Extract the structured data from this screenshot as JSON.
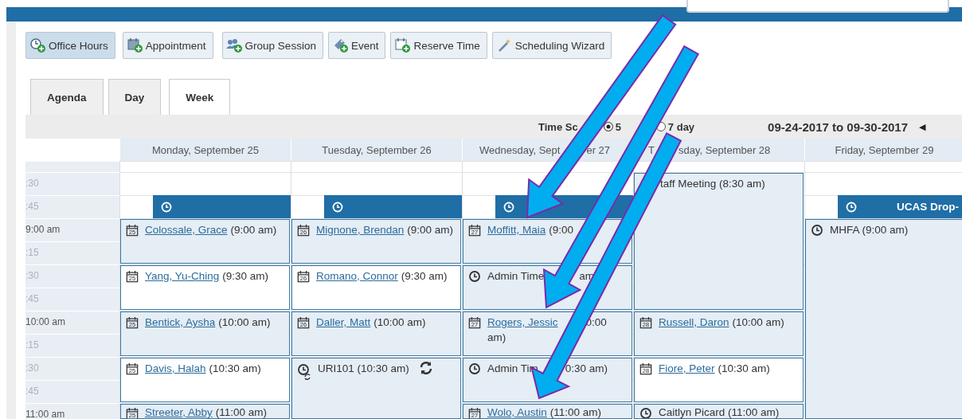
{
  "header_field": {
    "kind": "input"
  },
  "toolbar": [
    {
      "label": "Office Hours",
      "selected": true
    },
    {
      "label": "Appointment",
      "selected": false
    },
    {
      "label": "Group Session",
      "selected": false
    },
    {
      "label": "Event",
      "selected": false
    },
    {
      "label": "Reserve Time",
      "selected": false
    },
    {
      "label": "Scheduling Wizard",
      "selected": false
    }
  ],
  "tabs": [
    {
      "label": "Agenda",
      "selected": false
    },
    {
      "label": "Day",
      "selected": false
    },
    {
      "label": "Week",
      "selected": true
    }
  ],
  "time_scale": {
    "label": "Time Sc",
    "options": [
      {
        "label": "5",
        "selected": true
      },
      {
        "label": "7 day",
        "selected": false
      }
    ]
  },
  "date_range": "09-24-2017 to 09-30-2017",
  "prev_arrow": "◀",
  "time_labels": [
    ":30",
    ":45",
    "9:00 am",
    ":15",
    ":30",
    ":45",
    "10:00 am",
    ":15",
    ":30",
    ":45",
    "11:00 am"
  ],
  "days": [
    {
      "title": [
        "Monday, September 25"
      ],
      "bar": {
        "kind": "office_hours"
      },
      "events": [
        {
          "kind": "appointment",
          "icon_day": "25",
          "shaded": true,
          "parts": [
            {
              "text": "Colossale, Grace",
              "kind": "link"
            },
            {
              "text": "(9:00 am)",
              "kind": "text"
            }
          ]
        },
        {
          "kind": "appointment",
          "icon_day": "25",
          "shaded": false,
          "parts": [
            {
              "text": "Yang, Yu-Ching",
              "kind": "link"
            },
            {
              "text": "(9:30 am)",
              "kind": "text"
            }
          ]
        },
        {
          "kind": "appointment",
          "icon_day": "25",
          "shaded": true,
          "parts": [
            {
              "text": "Bentick, Aysha",
              "kind": "link"
            },
            {
              "text": "(10:00 am)",
              "kind": "text"
            }
          ]
        },
        {
          "kind": "appointment",
          "icon_day": "25",
          "shaded": false,
          "parts": [
            {
              "text": "Davis, Halah",
              "kind": "link"
            },
            {
              "text": "(10:30 am)",
              "kind": "text"
            }
          ]
        },
        {
          "kind": "appointment",
          "icon_day": "25",
          "shaded": true,
          "parts": [
            {
              "text": "Streeter, Abby",
              "kind": "link"
            },
            {
              "text": "(11:00 am)",
              "kind": "text"
            }
          ]
        }
      ]
    },
    {
      "title": [
        "Tuesday, September 26"
      ],
      "bar": {
        "kind": "office_hours"
      },
      "events": [
        {
          "kind": "appointment",
          "icon_day": "26",
          "shaded": true,
          "parts": [
            {
              "text": "Mignone, Brendan",
              "kind": "link"
            },
            {
              "text": "(9:00 am)",
              "kind": "text"
            }
          ]
        },
        {
          "kind": "appointment",
          "icon_day": "26",
          "shaded": false,
          "parts": [
            {
              "text": "Romano, Connor",
              "kind": "link"
            },
            {
              "text": "(9:30 am)",
              "kind": "text"
            }
          ]
        },
        {
          "kind": "appointment",
          "icon_day": "26",
          "shaded": true,
          "parts": [
            {
              "text": "Daller, Matt",
              "kind": "link"
            },
            {
              "text": "(10:00 am)",
              "kind": "text"
            }
          ]
        },
        {
          "kind": "recurring",
          "shaded": true,
          "parts": [
            {
              "text": "URI101 (10:30 am)",
              "kind": "text"
            }
          ]
        }
      ]
    },
    {
      "title": [
        "Wednesday, Sept",
        "er 27"
      ],
      "bar": {
        "kind": "office_hours"
      },
      "events": [
        {
          "kind": "appointment",
          "icon_day": "27",
          "shaded": true,
          "parts": [
            {
              "text": "Moffitt, Maia",
              "kind": "link"
            },
            {
              "text": "(9:00",
              "kind": "text"
            }
          ]
        },
        {
          "kind": "block",
          "shaded": true,
          "parts": [
            {
              "text": "Admin Time",
              "kind": "text"
            },
            {
              "text": "am",
              "kind": "text"
            }
          ]
        },
        {
          "kind": "appointment",
          "icon_day": "27",
          "shaded": true,
          "parts": [
            {
              "text": "Rogers, Jessic",
              "kind": "link"
            },
            {
              "text": "0:00",
              "kind": "text"
            },
            {
              "text": "am)",
              "kind": "text"
            }
          ]
        },
        {
          "kind": "block",
          "shaded": true,
          "parts": [
            {
              "text": "Admin Tim",
              "kind": "text"
            },
            {
              "text": "0:30 am)",
              "kind": "text"
            }
          ]
        },
        {
          "kind": "appointment",
          "icon_day": "27",
          "shaded": true,
          "parts": [
            {
              "text": "Wolo, Austin",
              "kind": "link"
            },
            {
              "text": "(11:00 am)",
              "kind": "text"
            }
          ]
        }
      ]
    },
    {
      "title": [
        "T",
        "sday, September 28"
      ],
      "events": [
        {
          "kind": "note",
          "shaded": true,
          "parts": [
            {
              "text": "taff Meeting (8:30 am)",
              "kind": "text"
            }
          ]
        },
        {
          "kind": "appointment",
          "icon_day": "28",
          "shaded": true,
          "parts": [
            {
              "text": "Russell, Daron",
              "kind": "link"
            },
            {
              "text": "(10:00 am)",
              "kind": "text"
            }
          ]
        },
        {
          "kind": "appointment",
          "icon_day": "28",
          "shaded": false,
          "parts": [
            {
              "text": "Fiore, Peter",
              "kind": "link"
            },
            {
              "text": "(10:30 am)",
              "kind": "text"
            }
          ]
        },
        {
          "kind": "block",
          "shaded": true,
          "parts": [
            {
              "text": "Caitlyn Picard (11:00 am)",
              "kind": "text"
            }
          ]
        }
      ]
    },
    {
      "title": [
        "Friday, September 29"
      ],
      "bar": {
        "kind": "office_hours",
        "title": "UCAS Drop-"
      },
      "events": [
        {
          "kind": "block",
          "shaded": true,
          "parts": [
            {
              "text": "MHFA (9:00 am)",
              "kind": "text"
            }
          ]
        }
      ]
    }
  ],
  "overlay": [
    {
      "kind": "arrow"
    },
    {
      "kind": "arrow"
    },
    {
      "kind": "arrow"
    }
  ]
}
